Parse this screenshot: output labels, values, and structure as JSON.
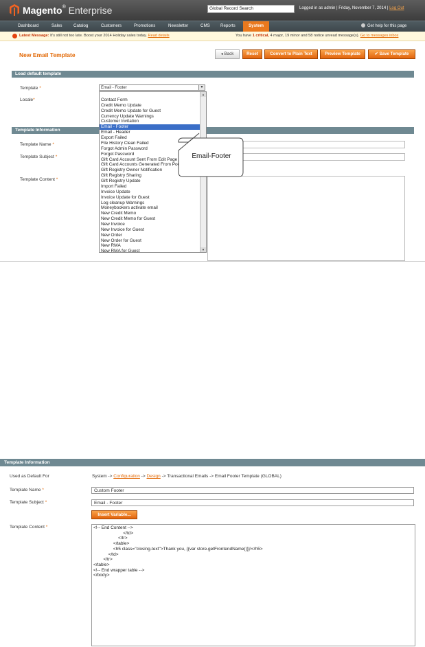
{
  "app": {
    "logo_brand": "Magento",
    "logo_suffix": "Enterprise",
    "search_value": "Global Record Search",
    "login_text": "Logged in as admin  |  Friday, November 7, 2014  |",
    "logout": "Log Out",
    "help": "Get help for this page"
  },
  "nav": [
    "Dashboard",
    "Sales",
    "Catalog",
    "Customers",
    "Promotions",
    "Newsletter",
    "CMS",
    "Reports",
    "System"
  ],
  "messages": {
    "latest_label": "Latest Message:",
    "latest_text": "It's still not too late. Boost your 2014 Holiday sales today.",
    "read_details": "Read details",
    "summary_pre": "You have",
    "critical": "1 critical,",
    "summary_post": "4 major, 19 minor and 58 notice unread message(s).",
    "goto": "Go to messages inbox"
  },
  "page": {
    "title": "New Email Template",
    "buttons": {
      "back": "Back",
      "reset": "Reset",
      "convert": "Convert to Plain Text",
      "preview": "Preview Template",
      "save": "Save Template"
    }
  },
  "load_default": {
    "header": "Load default template",
    "template_label": "Template",
    "locale_label": "Locale",
    "selected": "Email - Footer",
    "options": [
      "Contact Form",
      "Credit Memo Update",
      "Credit Memo Update for Guest",
      "Currency Update Warnings",
      "Customer Invitation",
      "Email - Footer",
      "Email - Header",
      "Export Failed",
      "File History Clean Failed",
      "Forgot Admin Password",
      "Forgot Password",
      "Gift Card Account Sent From Edit Page",
      "Gift Card Accounts Generated From Pool",
      "Gift Registry Owner Notification",
      "Gift Registry Sharing",
      "Gift Registry Update",
      "Import Failed",
      "Invoice Update",
      "Invoice Update for Guest",
      "Log cleanup Warnings",
      "Moneybookers activate email",
      "New Credit Memo",
      "New Credit Memo for Guest",
      "New Invoice",
      "New Invoice for Guest",
      "New Order",
      "New Order for Guest",
      "New RMA",
      "New RMA for Guest"
    ],
    "selected_index": 5
  },
  "template_info": {
    "header": "Template Information",
    "name_label": "Template Name",
    "subject_label": "Template Subject",
    "content_label": "Template Content"
  },
  "callout": "Email-Footer",
  "shot2": {
    "header": "Template Information",
    "used_label": "Used as Default For",
    "used_pre": "System ->",
    "used_link1": "Configuration",
    "used_arrow": "->",
    "used_link2": "Design",
    "used_post": "-> Transactional Emails -> Email Footer Template  (GLOBAL)",
    "name_label": "Template Name",
    "name_value": "Custom Footer",
    "subject_label": "Template Subject",
    "subject_value": "Email - Footer",
    "insert_variable": "Insert Variable...",
    "content_label": "Template Content",
    "content_lines": [
      "<!-- End Content -->",
      "                        </td>",
      "                    </tr>",
      "                </table>",
      "                <h5 class=\"closing-text\">Thank you, {{var store.getFrontendName()}}!</h5>",
      "            </td>",
      "        </tr>",
      "</table>",
      "<!-- End wrapper table -->",
      "</body>"
    ]
  }
}
